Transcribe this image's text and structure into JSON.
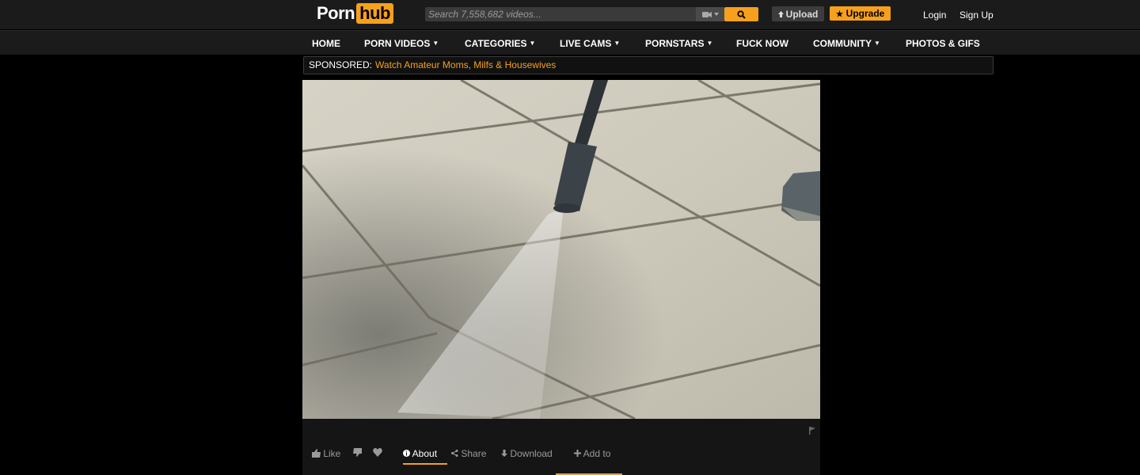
{
  "header": {
    "logo_left": "Porn",
    "logo_right": "hub",
    "search_placeholder": "Search 7,558,682 videos...",
    "upload_label": "Upload",
    "upgrade_label": "Upgrade",
    "login_label": "Login",
    "signup_label": "Sign Up"
  },
  "nav": {
    "items": [
      {
        "label": "HOME"
      },
      {
        "label": "PORN VIDEOS"
      },
      {
        "label": "CATEGORIES"
      },
      {
        "label": "LIVE CAMS"
      },
      {
        "label": "PORNSTARS"
      },
      {
        "label": "FUCK NOW"
      },
      {
        "label": "COMMUNITY"
      },
      {
        "label": "PHOTOS & GIFS"
      }
    ]
  },
  "sponsored": {
    "label": "SPONSORED:",
    "link_text": "Watch Amateur Moms, Milfs & Housewives"
  },
  "actions": {
    "like": "Like",
    "about": "About",
    "share": "Share",
    "download": "Download",
    "add_to": "Add to"
  },
  "colors": {
    "brand_orange": "#f7a01d",
    "header_bg": "#1b1b1b",
    "page_bg": "#000000"
  }
}
